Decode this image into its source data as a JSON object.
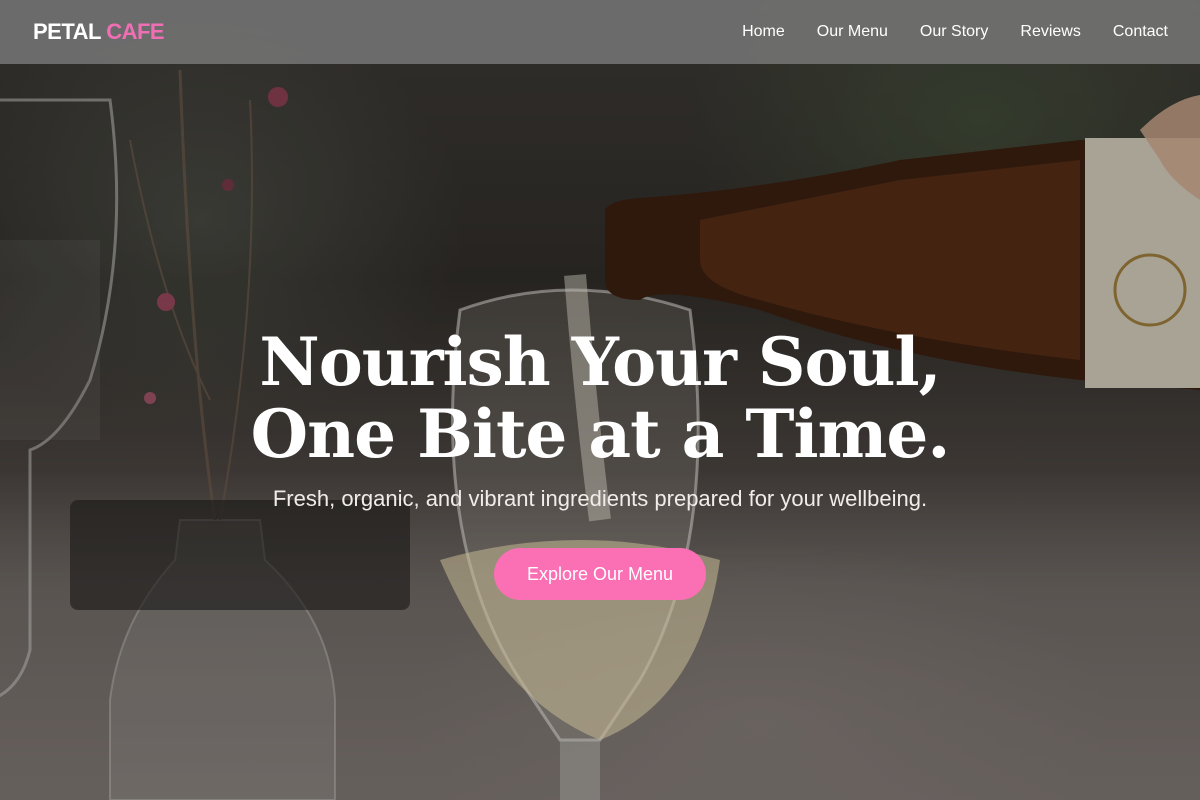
{
  "header": {
    "logo_main": "PETAL",
    "logo_accent": "CAFE",
    "nav": [
      {
        "label": "Home"
      },
      {
        "label": "Our Menu"
      },
      {
        "label": "Our Story"
      },
      {
        "label": "Reviews"
      },
      {
        "label": "Contact"
      }
    ]
  },
  "hero": {
    "headline_line1": "Nourish Your Soul,",
    "headline_line2": "One Bite at a Time.",
    "subtitle": "Fresh, organic, and vibrant ingredients prepared for your wellbeing.",
    "cta_label": "Explore Our Menu"
  },
  "colors": {
    "accent": "#fb6fb4",
    "logo_accent": "#f06fb4",
    "header_bg": "#6e6e6e",
    "text": "#ffffff"
  }
}
